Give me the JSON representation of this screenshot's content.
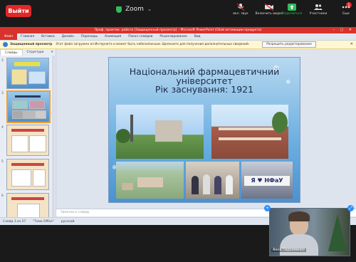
{
  "zoom": {
    "leave_label": "Выйти",
    "title": "Zoom",
    "buttons": [
      {
        "label": "вкл. звук",
        "icon": "mic-muted-icon"
      },
      {
        "label": "Включить видео",
        "icon": "video-off-icon"
      },
      {
        "label": "Поделиться",
        "icon": "share-screen-icon"
      },
      {
        "label": "Участники",
        "icon": "participants-icon",
        "badge": "1"
      },
      {
        "label": "Еще",
        "icon": "more-icon"
      }
    ],
    "share_color": "#2ebd59",
    "leave_color": "#e02828"
  },
  "powerpoint": {
    "title": "Проф. практик. робота [Защищенный просмотр] – Microsoft PowerPoint (Сбой активации продукта)",
    "tabs": [
      "Файл",
      "Главная",
      "Вставка",
      "Дизайн",
      "Переходы",
      "Анимация",
      "Показ слайдов",
      "Рецензирование",
      "Вид"
    ],
    "protected_label": "Защищенный просмотр",
    "protected_text": "Этот файл загружен из Интернета и может быть небезопасным. Щелкните для получения дополнительных сведений.",
    "enable_edit_label": "Разрешить редактирование",
    "pane_tabs": [
      "Слайды",
      "Структура"
    ],
    "thumb_numbers": [
      "2",
      "3",
      "4",
      "5",
      "6"
    ],
    "notes_placeholder": "Заметки к слайду",
    "status": {
      "slide_counter": "Слайд 3 из 27",
      "theme": "\"Тема Office\"",
      "language": "русский"
    }
  },
  "slide": {
    "title_line1": "Національний  фармацевтичний",
    "title_line2": "університет",
    "title_line3": "Рік заснування:  1921",
    "banner_text": "Я ♥ НФаУ"
  },
  "video": {
    "participant_name": "Анна Пархоменко"
  }
}
